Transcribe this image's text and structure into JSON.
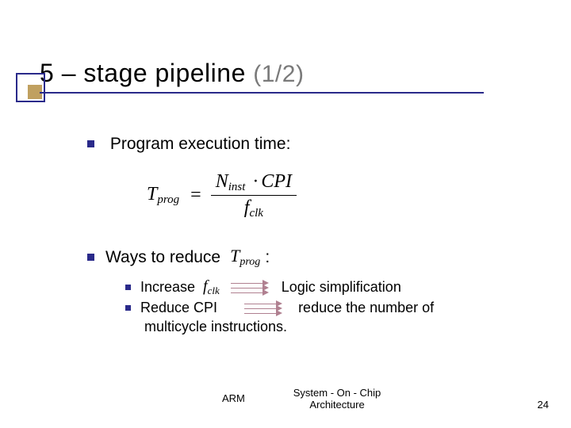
{
  "title": {
    "main": "5 – stage pipeline",
    "sub": "(1/2)"
  },
  "bullets": {
    "b1": "Program execution time:",
    "b2_prefix": "Ways to reduce",
    "b2_suffix": ":",
    "s1_pre": "Increase",
    "s1_post": "Logic simplification",
    "s2_line1_pre": "Reduce CPI",
    "s2_line1_post": "reduce the number of",
    "s2_line2": "multicycle instructions."
  },
  "formula": {
    "lhs_T": "T",
    "lhs_sub": "prog",
    "eq": "=",
    "num_N": "N",
    "num_sub": "inst",
    "dot": "·",
    "num_cpi": "CPI",
    "den_f": "f",
    "den_sub": "clk"
  },
  "inline": {
    "tprog_T": "T",
    "tprog_sub": "prog",
    "fclk_f": "f",
    "fclk_sub": "clk"
  },
  "footer": {
    "left": "ARM",
    "center_l1": "System - On - Chip",
    "center_l2": "Architecture",
    "page": "24"
  }
}
